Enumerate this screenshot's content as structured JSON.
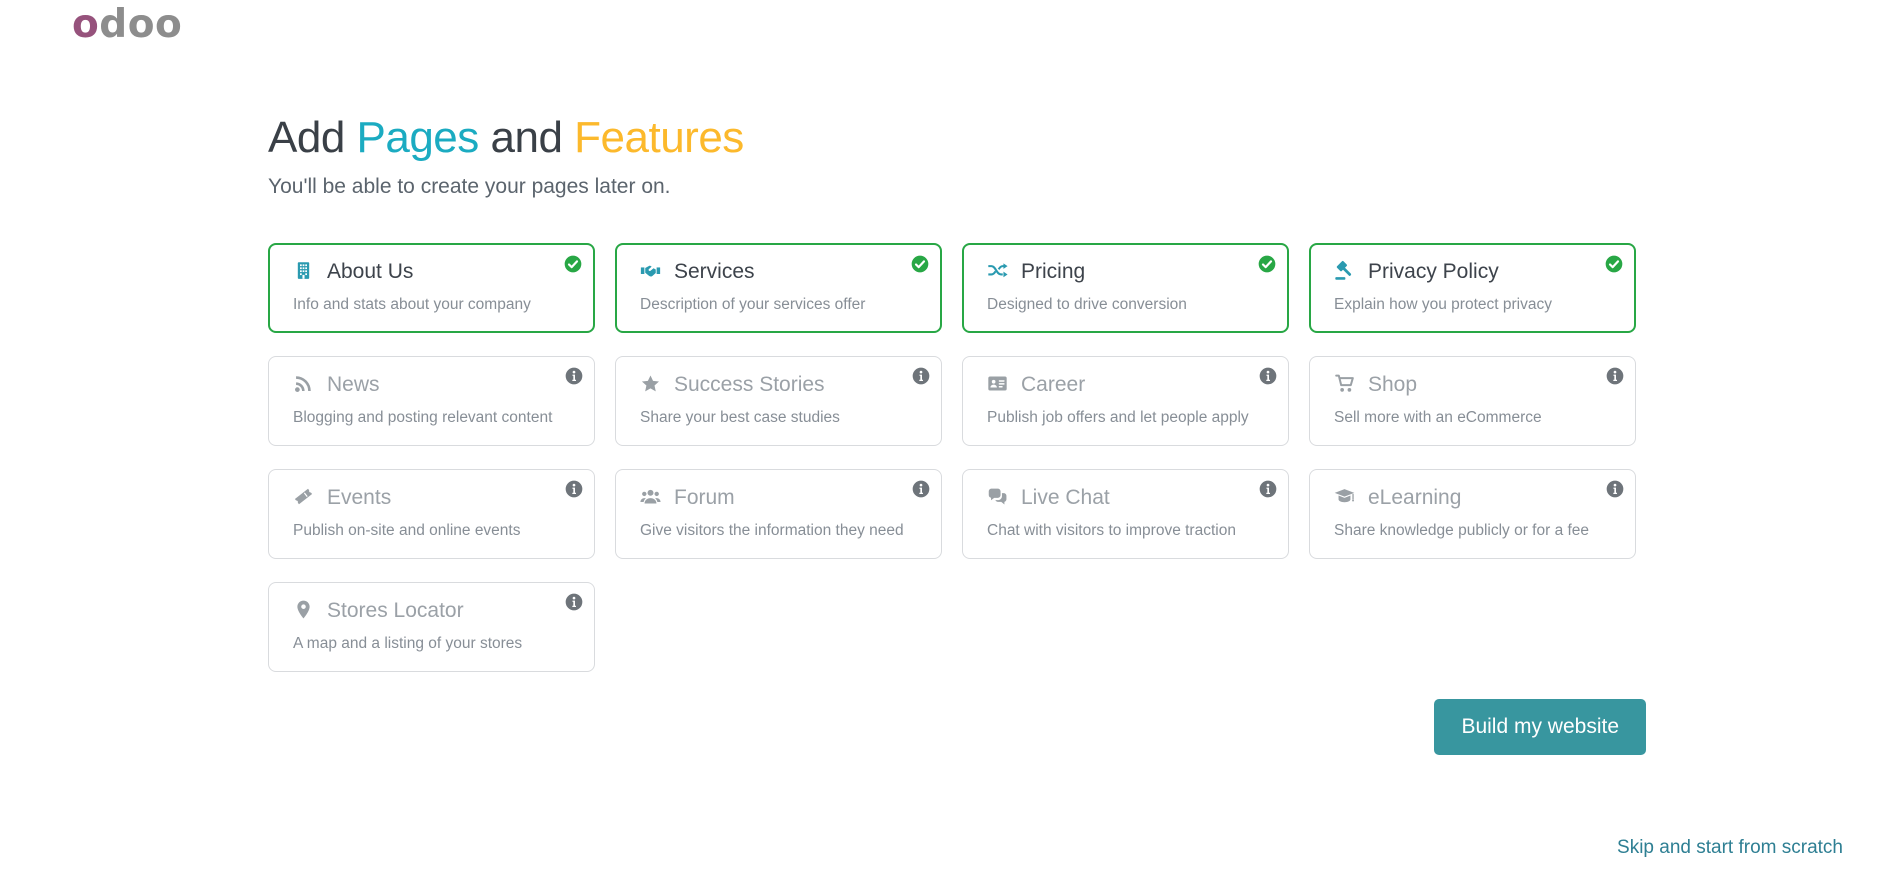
{
  "logo": {
    "first": "o",
    "rest": "doo"
  },
  "title": {
    "part1": "Add ",
    "accent1": "Pages",
    "part2": " and ",
    "accent2": "Features"
  },
  "subtitle": "You'll be able to create your pages later on.",
  "cards": [
    {
      "label": "About Us",
      "description": "Info and stats about your company",
      "icon": "building",
      "selected": true
    },
    {
      "label": "Services",
      "description": "Description of your services offer",
      "icon": "handshake",
      "selected": true
    },
    {
      "label": "Pricing",
      "description": "Designed to drive conversion",
      "icon": "shuffle",
      "selected": true
    },
    {
      "label": "Privacy Policy",
      "description": "Explain how you protect privacy",
      "icon": "gavel",
      "selected": true
    },
    {
      "label": "News",
      "description": "Blogging and posting relevant content",
      "icon": "rss",
      "selected": false
    },
    {
      "label": "Success Stories",
      "description": "Share your best case studies",
      "icon": "star",
      "selected": false
    },
    {
      "label": "Career",
      "description": "Publish job offers and let people apply",
      "icon": "address-card",
      "selected": false
    },
    {
      "label": "Shop",
      "description": "Sell more with an eCommerce",
      "icon": "shopping-cart",
      "selected": false
    },
    {
      "label": "Events",
      "description": "Publish on-site and online events",
      "icon": "ticket",
      "selected": false
    },
    {
      "label": "Forum",
      "description": "Give visitors the information they need",
      "icon": "users",
      "selected": false
    },
    {
      "label": "Live Chat",
      "description": "Chat with visitors to improve traction",
      "icon": "comments",
      "selected": false
    },
    {
      "label": "eLearning",
      "description": "Share knowledge publicly or for a fee",
      "icon": "graduation-cap",
      "selected": false
    },
    {
      "label": "Stores Locator",
      "description": "A map and a listing of your stores",
      "icon": "map-marker",
      "selected": false
    }
  ],
  "status_icons": {
    "selected": "check-circle-icon",
    "unselected": "info-circle-icon"
  },
  "footer": {
    "build_button": "Build my website",
    "skip_link": "Skip and start from scratch"
  },
  "colors": {
    "accent_teal": "#1babc1",
    "accent_yellow": "#fcb92c",
    "selected_green": "#28a745",
    "icon_teal": "#2a9ab0",
    "button_teal": "#38969f",
    "link_teal": "#2e7f93",
    "logo_purple": "#96527c"
  }
}
